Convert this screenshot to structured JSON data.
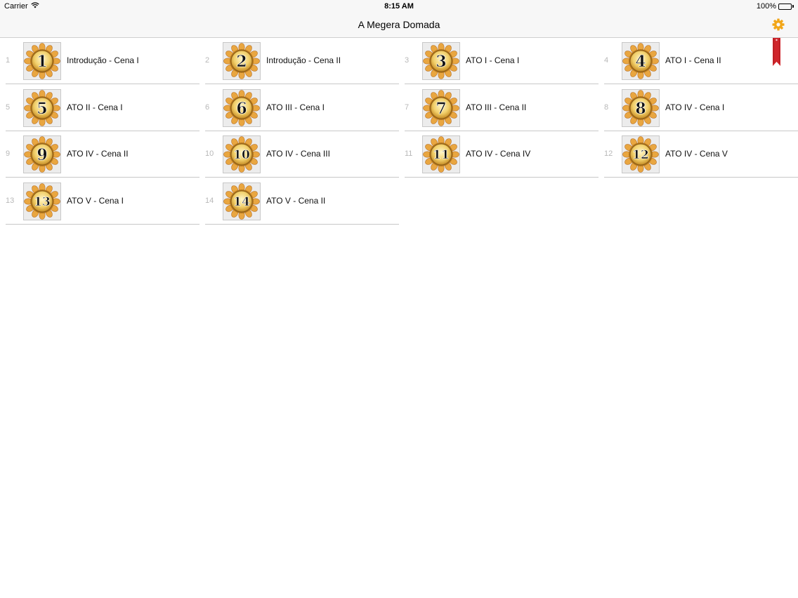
{
  "status": {
    "carrier": "Carrier",
    "time": "8:15 AM",
    "battery": "100%",
    "battery_level": 1.0
  },
  "nav": {
    "title": "A Megera Domada"
  },
  "colors": {
    "accent": "#f2a618",
    "bookmark": "#d0252b",
    "index_text": "#b8b8b8",
    "separator": "#c8c8c8"
  },
  "icons": {
    "settings": "gear-icon",
    "bookmark": "bookmark-ribbon-icon"
  },
  "items": [
    {
      "index": "1",
      "badge": "1",
      "label": "Introdução - Cena I"
    },
    {
      "index": "2",
      "badge": "2",
      "label": "Introdução - Cena II"
    },
    {
      "index": "3",
      "badge": "3",
      "label": "ATO I - Cena I"
    },
    {
      "index": "4",
      "badge": "4",
      "label": "ATO I - Cena II"
    },
    {
      "index": "5",
      "badge": "5",
      "label": "ATO II - Cena I"
    },
    {
      "index": "6",
      "badge": "6",
      "label": "ATO III - Cena I"
    },
    {
      "index": "7",
      "badge": "7",
      "label": "ATO III - Cena II"
    },
    {
      "index": "8",
      "badge": "8",
      "label": "ATO IV - Cena I"
    },
    {
      "index": "9",
      "badge": "9",
      "label": "ATO IV - Cena II"
    },
    {
      "index": "10",
      "badge": "10",
      "label": "ATO IV - Cena III"
    },
    {
      "index": "11",
      "badge": "11",
      "label": "ATO IV - Cena IV"
    },
    {
      "index": "12",
      "badge": "12",
      "label": "ATO IV - Cena V"
    },
    {
      "index": "13",
      "badge": "13",
      "label": "ATO V - Cena I"
    },
    {
      "index": "14",
      "badge": "14",
      "label": "ATO V - Cena II"
    }
  ]
}
